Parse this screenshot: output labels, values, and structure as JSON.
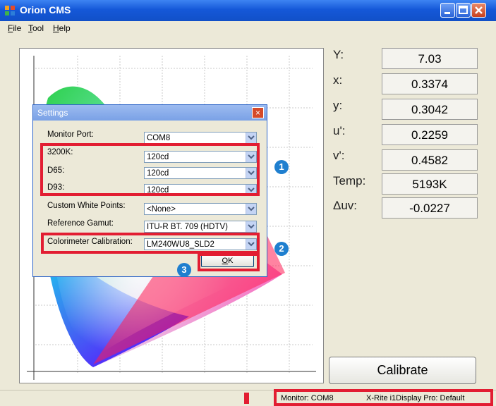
{
  "app": {
    "title": "Orion CMS"
  },
  "menu": [
    {
      "label": "File",
      "u": "F",
      "rest": "ile"
    },
    {
      "label": "Tool",
      "u": "T",
      "rest": "ool"
    },
    {
      "label": "Help",
      "u": "H",
      "rest": "elp"
    }
  ],
  "readouts": [
    {
      "label": "Y:",
      "value": "7.03"
    },
    {
      "label": "x:",
      "value": "0.3374"
    },
    {
      "label": "y:",
      "value": "0.3042"
    },
    {
      "label": "u':",
      "value": "0.2259"
    },
    {
      "label": "v':",
      "value": "0.4582"
    },
    {
      "label": "Temp:",
      "value": "5193K"
    },
    {
      "label": "Δuv:",
      "value": "-0.0227"
    }
  ],
  "calibrate_label": "Calibrate",
  "status": {
    "monitor": "Monitor: COM8",
    "device": "X-Rite i1Display Pro: Default"
  },
  "settings": {
    "title": "Settings",
    "close": "×",
    "fields": [
      {
        "label": "Monitor Port:",
        "value": "COM8"
      },
      {
        "label": "3200K:",
        "value": "120cd"
      },
      {
        "label": "D65:",
        "value": "120cd"
      },
      {
        "label": "D93:",
        "value": "120cd"
      },
      {
        "label": "Custom White Points:",
        "value": "<None>"
      },
      {
        "label": "Reference Gamut:",
        "value": "ITU-R BT. 709 (HDTV)"
      },
      {
        "label": "Colorimeter Calibration:",
        "value": "LM240WU8_SLD2"
      }
    ],
    "ok_u": "O",
    "ok_rest": "K"
  },
  "badges": [
    "1",
    "2",
    "3"
  ],
  "colors": {
    "accent_red": "#e21d32",
    "badge_blue": "#1f7fcf",
    "titlebar_blue": "#1558d8"
  }
}
